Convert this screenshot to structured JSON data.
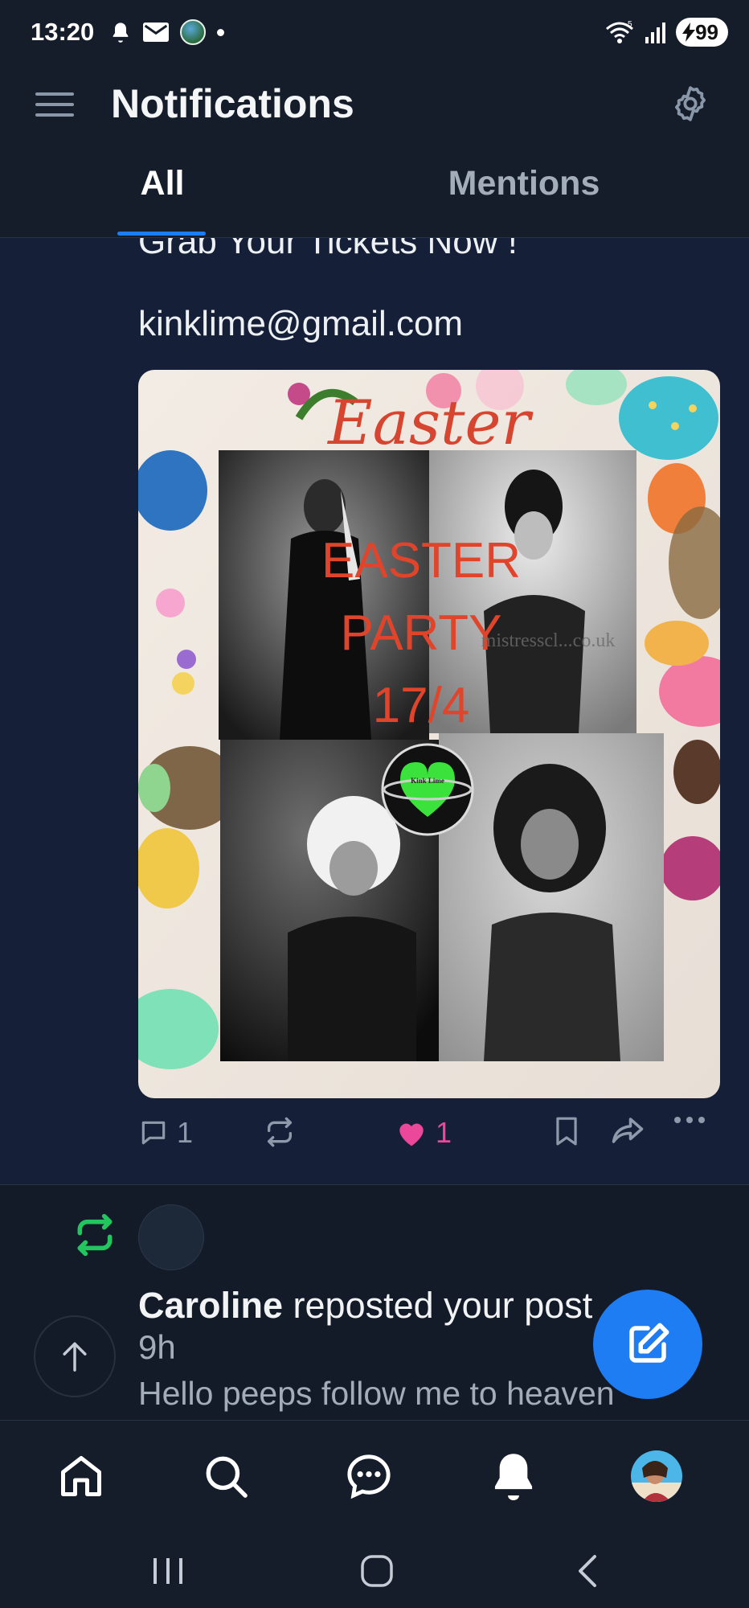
{
  "status_bar": {
    "time": "13:20",
    "battery": "99",
    "network_label": "5"
  },
  "header": {
    "title": "Notifications"
  },
  "tabs": [
    {
      "label": "All",
      "selected": true
    },
    {
      "label": "Mentions",
      "selected": false
    }
  ],
  "post": {
    "clipped_text": "Grab Your Tickets Now !",
    "email": "kinklime@gmail.com",
    "image": {
      "title_script": "Easter",
      "headline_line1": "EASTER",
      "headline_line2": "PARTY",
      "date": "17/4",
      "watermark": "mistresscl...co.uk",
      "logo_text": "Kink Lime"
    },
    "actions": {
      "reply_count": "1",
      "like_count": "1"
    }
  },
  "repost_notification": {
    "user": "Caroline",
    "action_text": " reposted your post",
    "time": "9h",
    "snippet": "Hello peeps follow me to heaven"
  },
  "colors": {
    "accent": "#1e7df2",
    "like": "#ec4899",
    "repost": "#22c55e",
    "background": "#111a27"
  }
}
